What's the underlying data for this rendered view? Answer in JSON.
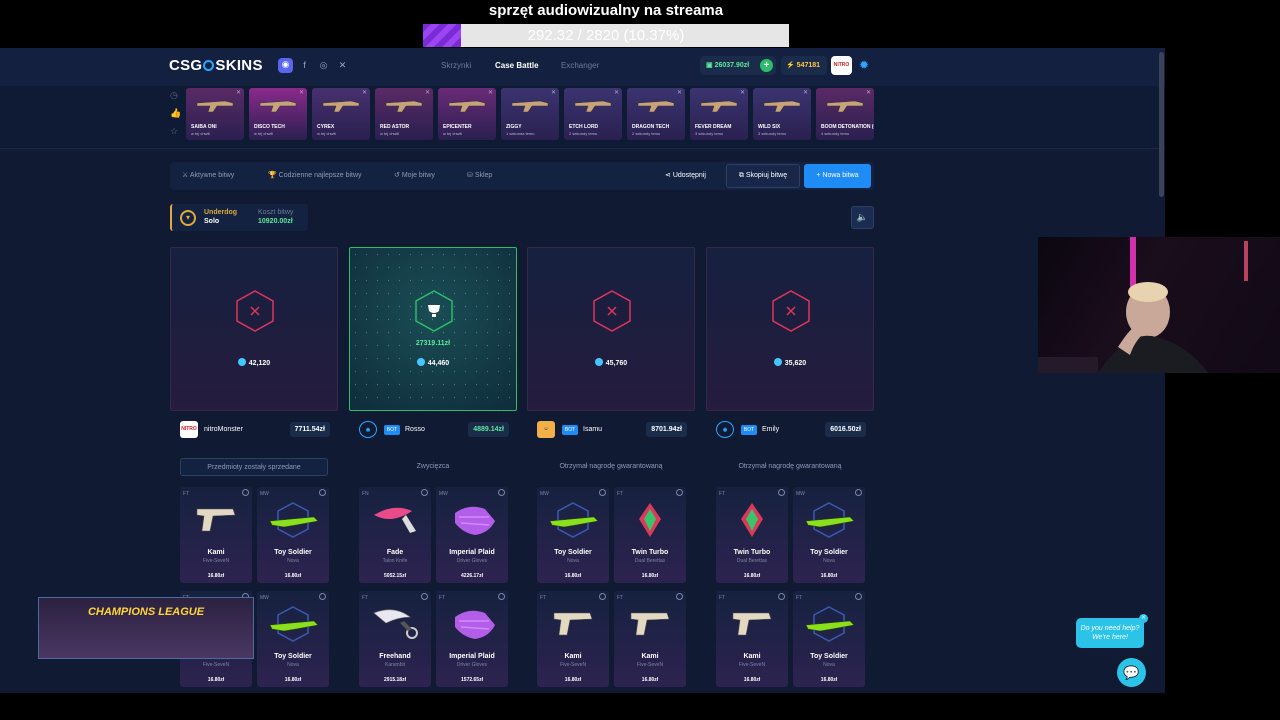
{
  "stream": {
    "title": "sprzęt audiowizualny na streama",
    "goal_text": "292.32 / 2820 (10.37%)",
    "goal_fraction": 0.1037
  },
  "header": {
    "logo_left": "CSG",
    "logo_right": "SKINS",
    "nav": [
      "Skrzynki",
      "Case Battle",
      "Exchanger"
    ],
    "active_nav": "Case Battle",
    "balance": "26037.90zł",
    "balance_plus": "+",
    "coins": "547181"
  },
  "live_drops": [
    {
      "name": "SAIBA ONI",
      "sub": "w tej chwili",
      "bg": "#5a2a66"
    },
    {
      "name": "DISCO TECH",
      "sub": "w tej chwili",
      "bg": "#8a2a8c"
    },
    {
      "name": "CYREX",
      "sub": "w tej chwili",
      "bg": "#47306e"
    },
    {
      "name": "RED ASTOR",
      "sub": "w tej chwili",
      "bg": "#5a2a66"
    },
    {
      "name": "EPICENTER",
      "sub": "w tej chwili",
      "bg": "#6a2a78"
    },
    {
      "name": "ZIGGY",
      "sub": "1 sekunda temu",
      "bg": "#3a3470"
    },
    {
      "name": "ETCH LORD",
      "sub": "2 sekundy temu",
      "bg": "#3a3470"
    },
    {
      "name": "DRAGON TECH",
      "sub": "2 sekundy temu",
      "bg": "#3a3470"
    },
    {
      "name": "FEVER DREAM",
      "sub": "3 sekundy temu",
      "bg": "#3a3470"
    },
    {
      "name": "WILD SIX",
      "sub": "3 sekundy temu",
      "bg": "#3a3470"
    },
    {
      "name": "BOOM DETONATION (GLITTER)",
      "sub": "4 sekundy temu",
      "bg": "#5a2a66"
    }
  ],
  "tabs": [
    "Aktywne bitwy",
    "Codzienne najlepsze bitwy",
    "Moje bitwy",
    "Sklep"
  ],
  "actions": {
    "share": "Udostępnij",
    "copy": "Skopiuj bitwę",
    "new": "+ Nowa bitwa"
  },
  "battle": {
    "mode_name": "Underdog",
    "mode_sub": "Solo",
    "cost_label": "Koszt bitwy",
    "cost_value": "10920.00zł"
  },
  "players": [
    {
      "name": "nitroMonster",
      "total": "7711.54zł",
      "bot": false,
      "score": "42,120",
      "winner": false,
      "win_value": "",
      "status": "Przedmioty zostały sprzedane",
      "items": [
        {
          "cond": "FT",
          "name": "Kami",
          "sub": "Five-SeveN",
          "value": "16.80zł",
          "kind": "pistol"
        },
        {
          "cond": "MW",
          "name": "Toy Soldier",
          "sub": "Nova",
          "value": "16.80zł",
          "kind": "shotgun"
        },
        {
          "cond": "FT",
          "name": "Kami",
          "sub": "Five-SeveN",
          "value": "16.80zł",
          "kind": "pistol"
        },
        {
          "cond": "MW",
          "name": "Toy Soldier",
          "sub": "Nova",
          "value": "16.80zł",
          "kind": "shotgun"
        }
      ]
    },
    {
      "name": "Rosso",
      "total": "4889.14zł",
      "bot": true,
      "score": "44,460",
      "winner": true,
      "win_value": "27319.11zł",
      "status": "Zwycięzca",
      "items": [
        {
          "cond": "FN",
          "name": "Fade",
          "sub": "Talon Knife",
          "value": "5052.15zł",
          "kind": "knife"
        },
        {
          "cond": "MW",
          "name": "Imperial Plaid",
          "sub": "Driver Gloves",
          "value": "4226.17zł",
          "kind": "gloves"
        },
        {
          "cond": "FT",
          "name": "Freehand",
          "sub": "Karambit",
          "value": "2915.18zł",
          "kind": "karambit"
        },
        {
          "cond": "FT",
          "name": "Imperial Plaid",
          "sub": "Driver Gloves",
          "value": "1572.65zł",
          "kind": "gloves"
        }
      ]
    },
    {
      "name": "Isamu",
      "total": "8701.94zł",
      "bot": true,
      "score": "45,760",
      "winner": false,
      "win_value": "",
      "status": "Otrzymał nagrodę gwarantowaną",
      "items": [
        {
          "cond": "MW",
          "name": "Toy Soldier",
          "sub": "Nova",
          "value": "16.80zł",
          "kind": "shotgun"
        },
        {
          "cond": "FT",
          "name": "Twin Turbo",
          "sub": "Dual Berettas",
          "value": "16.80zł",
          "kind": "dual"
        },
        {
          "cond": "FT",
          "name": "Kami",
          "sub": "Five-SeveN",
          "value": "16.80zł",
          "kind": "pistol"
        },
        {
          "cond": "FT",
          "name": "Kami",
          "sub": "Five-SeveN",
          "value": "16.80zł",
          "kind": "pistol"
        }
      ]
    },
    {
      "name": "Emily",
      "total": "6016.50zł",
      "bot": true,
      "score": "35,620",
      "winner": false,
      "win_value": "",
      "status": "Otrzymał nagrodę gwarantowaną",
      "items": [
        {
          "cond": "FT",
          "name": "Twin Turbo",
          "sub": "Dual Berettas",
          "value": "16.80zł",
          "kind": "dual"
        },
        {
          "cond": "MW",
          "name": "Toy Soldier",
          "sub": "Nova",
          "value": "16.80zł",
          "kind": "shotgun"
        },
        {
          "cond": "FT",
          "name": "Kami",
          "sub": "Five-SeveN",
          "value": "16.80zł",
          "kind": "pistol"
        },
        {
          "cond": "FT",
          "name": "Toy Soldier",
          "sub": "Nova",
          "value": "16.80zł",
          "kind": "shotgun"
        }
      ]
    }
  ],
  "overlay": {
    "title": "CHAMPIONS LEAGUE"
  },
  "help": {
    "text": "Do you need help? We're here!"
  },
  "colors": {
    "accent": "#1f8cf5",
    "win": "#2bbd68",
    "lose": "#e0335a",
    "gold": "#e0a93a"
  }
}
